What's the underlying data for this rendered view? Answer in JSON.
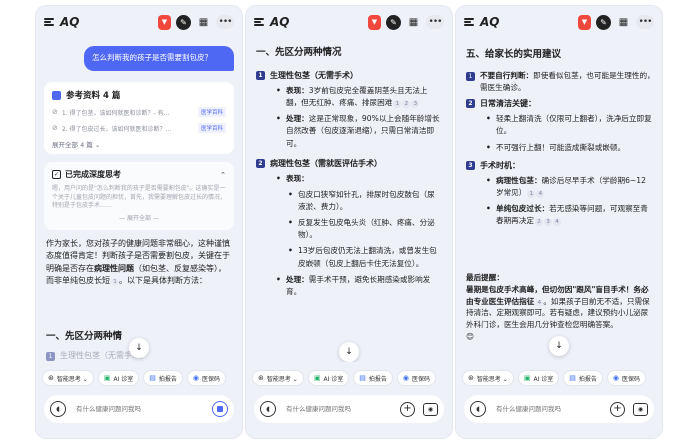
{
  "app": {
    "title": "AQ"
  },
  "panel1": {
    "user_question": "怎么判断我的孩子是否需要割包皮？",
    "references": {
      "title": "参考资料 4 篇",
      "items": [
        {
          "index": "1.",
          "text": "得了包茎，该如何就医和诊断？- 有...",
          "tag": "医学百科"
        },
        {
          "index": "2.",
          "text": "得了包皮过长，该如何就医和诊断？...",
          "tag": "医学百科"
        }
      ],
      "expand": "展开全部 4 篇 ⌄"
    },
    "thinking": {
      "title": "已完成深度思考",
      "body": "嗯，用户问的是\"怎么判断我的孩子是否需要割包皮\"。这确实是一个关于儿童包皮问题的担忧，首先，我需要理解包皮过长的情况，特别是于包皮手术……",
      "fold": "— 展开全部 —"
    },
    "answer": {
      "p1_a": "作为家长，您对孩子的健康问题非常细心，这种谨慎态度值得肯定！判断孩子是否需要割包皮，关键在于明确是否存在",
      "p1_bold": "病理性问题",
      "p1_b": "（如包茎、反复感染等），而非单纯包皮长短",
      "p1_cite": "1",
      "p1_c": "。以下是具体判断方法：",
      "sec1": "一、先区分两种情",
      "hidden_item": "生理性包茎（无需手术）"
    }
  },
  "panel2": {
    "sec_title": "一、先区分两种情况",
    "item1": {
      "num": "1",
      "title": "生理性包茎（无需手术）",
      "bullets": [
        {
          "label": "表现：",
          "text": "3岁前包皮完全覆盖阴茎头且无法上翻，但无红肿、疼痛、排尿困难",
          "cites": [
            "1",
            "2",
            "3"
          ]
        },
        {
          "label": "处理：",
          "text": "这是正常现象，90%以上会随年龄增长自然改善（包皮逐渐退缩），只需日常清洁即可。",
          "cites": []
        }
      ]
    },
    "item2": {
      "num": "2",
      "title": "病理性包茎（需就医评估手术）",
      "label": "表现：",
      "subs": [
        "包皮口狭窄如针孔，排尿时包皮鼓包（尿液淤、费力）。",
        "反复发生包皮龟头炎（红肿、疼痛、分泌物）。",
        "13岁后包皮仍无法上翻清洗，或曾发生包皮嵌顿（包皮上翻后卡住无法复位）。"
      ],
      "treat_label": "处理：",
      "treat": "需手术干预，避免长期感染或影响发育。"
    }
  },
  "panel3": {
    "sec_title": "五、给家长的实用建议",
    "item1": {
      "num": "1",
      "bold": "不要自行判断：",
      "text": "即使看似包茎，也可能是生理性的，需医生确诊。"
    },
    "item2": {
      "num": "2",
      "title": "日常清洁关键：",
      "bullets": [
        "轻柔上翻清洗（仅限可上翻者），洗净后立即复位。",
        "不可强行上翻！可能造成撕裂或嵌顿。"
      ]
    },
    "item3": {
      "num": "3",
      "title": "手术时机：",
      "bullets": [
        {
          "label": "病理性包茎：",
          "text": "确诊后尽早手术（学龄期6~12岁常见）",
          "cites": [
            "1",
            "4"
          ]
        },
        {
          "label": "单纯包皮过长：",
          "text": "若无感染等问题，可观察至青春期再决定",
          "cites": [
            "2",
            "3",
            "4"
          ]
        }
      ]
    },
    "final": {
      "title": "最后提醒：",
      "text_a": "暑期是包皮手术高峰，但切勿因",
      "quote": "\"跟风\"",
      "text_b": "盲目手术！务必由专业医生评估指征",
      "cite": "4",
      "text_c": "。如果孩子目前无不适，只需保持清洁、定期观察即可。若有疑虑，建议预约小儿泌尿外科门诊，医生会用几分钟",
      "text_d": "查检您明确答案。",
      "emoji": "😊"
    }
  },
  "toolbar": {
    "chips": [
      {
        "icon": "⊛",
        "label": "智能思考 ⌄"
      },
      {
        "icon": "▣",
        "label": "AI 诊室"
      },
      {
        "icon": "▤",
        "label": "拍报告"
      },
      {
        "icon": "◉",
        "label": "医保码"
      }
    ]
  },
  "input": {
    "placeholder": "有什么健康问题问我吗"
  },
  "colors": {
    "accent": "#4f68f4",
    "panel_bg": "#eef1f8",
    "badge": "#f2473d",
    "item_num": "#2f3c8f"
  }
}
